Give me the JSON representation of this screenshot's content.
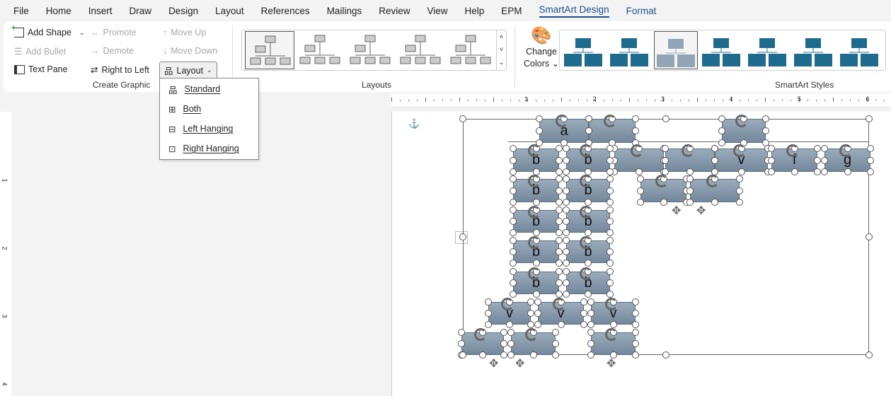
{
  "menu": {
    "tabs": [
      "File",
      "Home",
      "Insert",
      "Draw",
      "Design",
      "Layout",
      "References",
      "Mailings",
      "Review",
      "View",
      "Help",
      "EPM",
      "SmartArt Design",
      "Format"
    ],
    "active": "SmartArt Design"
  },
  "create_graphic": {
    "add_shape": "Add Shape",
    "add_bullet": "Add Bullet",
    "text_pane": "Text Pane",
    "promote": "Promote",
    "demote": "Demote",
    "right_to_left": "Right to Left",
    "move_up": "Move Up",
    "move_down": "Move Down",
    "layout": "Layout",
    "group_label": "Create Graphic"
  },
  "layouts": {
    "group_label": "Layouts"
  },
  "styles": {
    "change_colors_1": "Change",
    "change_colors_2": "Colors",
    "group_label": "SmartArt Styles",
    "color": "#1f6b8e"
  },
  "layout_menu": {
    "items": [
      "Standard",
      "Both",
      "Left Hanging",
      "Right Hanging"
    ]
  },
  "ruler": {
    "numbers": [
      "1",
      "2",
      "3",
      "4",
      "5",
      "6"
    ],
    "vnumbers": [
      "1",
      "2",
      "3",
      "4"
    ]
  },
  "diagram": {
    "labels": [
      "a",
      "",
      "",
      "b",
      "b",
      "",
      "",
      "",
      "v",
      "f",
      "g",
      "b",
      "b",
      "",
      "",
      "b",
      "b",
      "b",
      "b",
      "b",
      "b",
      "v",
      "v",
      "v",
      "",
      "",
      ""
    ]
  }
}
